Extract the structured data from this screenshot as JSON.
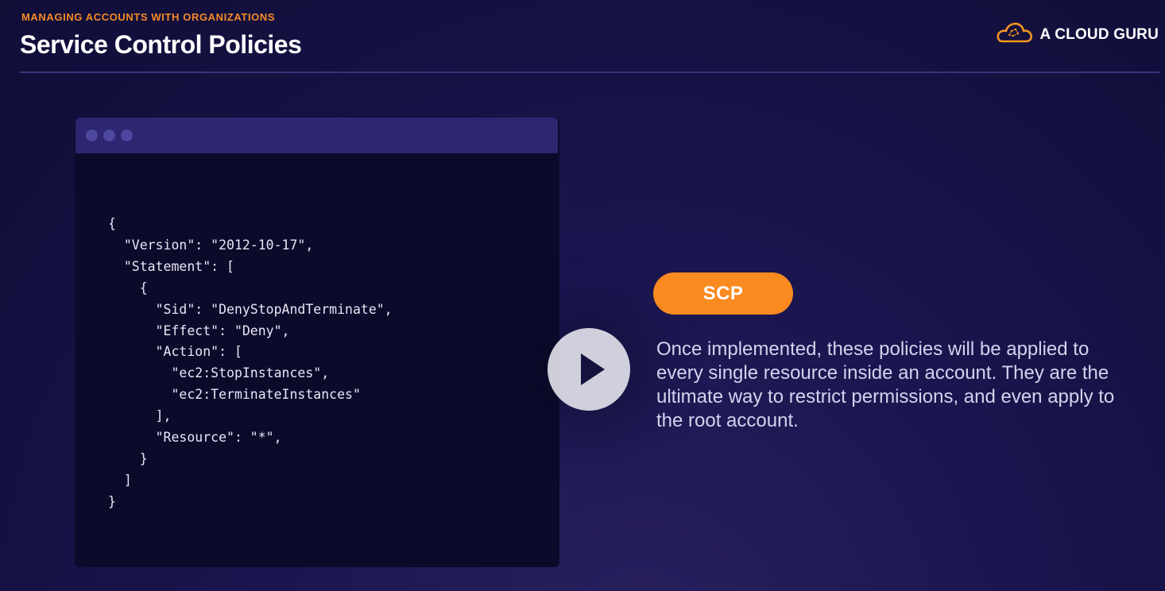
{
  "header": {
    "eyebrow": "MANAGING ACCOUNTS WITH ORGANIZATIONS",
    "title": "Service Control Policies"
  },
  "brand": {
    "name": "A CLOUD GURU",
    "icon": "cloud-logo-icon"
  },
  "code_window": {
    "code": "{\n  \"Version\": \"2012-10-17\",\n  \"Statement\": [\n    {\n      \"Sid\": \"DenyStopAndTerminate\",\n      \"Effect\": \"Deny\",\n      \"Action\": [\n        \"ec2:StopInstances\",\n        \"ec2:TerminateInstances\"\n      ],\n      \"Resource\": \"*\",\n    }\n  ]\n}"
  },
  "badge": {
    "label": "SCP"
  },
  "description": "Once implemented, these policies will be applied to every single resource inside an account. They are the ultimate way to restrict permissions, and even apply to the root account.",
  "colors": {
    "accent": "#f98a20",
    "background": "#1b1650",
    "code_background": "#0c0a2b",
    "titlebar": "#2d2670"
  }
}
